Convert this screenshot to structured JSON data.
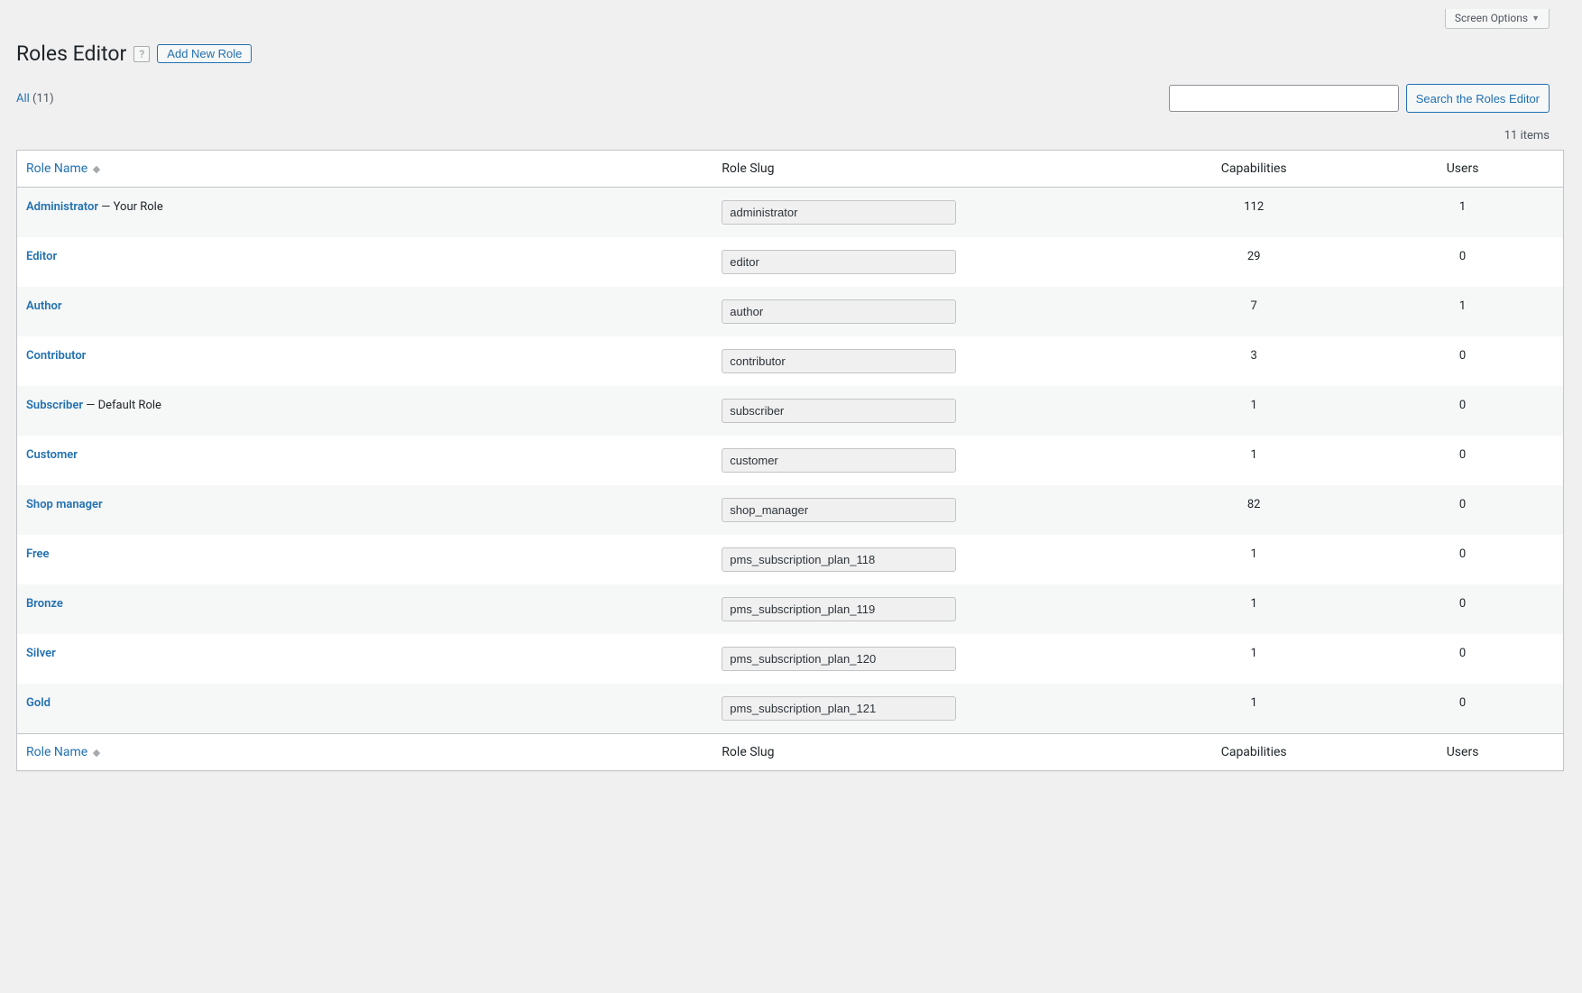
{
  "screenOptions": {
    "label": "Screen Options"
  },
  "header": {
    "title": "Roles Editor",
    "addNew": "Add New Role"
  },
  "filter": {
    "allLabel": "All",
    "allCount": "(11)"
  },
  "search": {
    "value": "",
    "button": "Search the Roles Editor"
  },
  "pagination": {
    "itemsLabel": "11 items"
  },
  "columns": {
    "name": "Role Name",
    "slug": "Role Slug",
    "caps": "Capabilities",
    "users": "Users"
  },
  "rows": [
    {
      "name": "Administrator",
      "note": " — Your Role",
      "slug": "administrator",
      "caps": "112",
      "users": "1"
    },
    {
      "name": "Editor",
      "note": "",
      "slug": "editor",
      "caps": "29",
      "users": "0"
    },
    {
      "name": "Author",
      "note": "",
      "slug": "author",
      "caps": "7",
      "users": "1"
    },
    {
      "name": "Contributor",
      "note": "",
      "slug": "contributor",
      "caps": "3",
      "users": "0"
    },
    {
      "name": "Subscriber",
      "note": " — Default Role",
      "slug": "subscriber",
      "caps": "1",
      "users": "0"
    },
    {
      "name": "Customer",
      "note": "",
      "slug": "customer",
      "caps": "1",
      "users": "0"
    },
    {
      "name": "Shop manager",
      "note": "",
      "slug": "shop_manager",
      "caps": "82",
      "users": "0"
    },
    {
      "name": "Free",
      "note": "",
      "slug": "pms_subscription_plan_118",
      "caps": "1",
      "users": "0"
    },
    {
      "name": "Bronze",
      "note": "",
      "slug": "pms_subscription_plan_119",
      "caps": "1",
      "users": "0"
    },
    {
      "name": "Silver",
      "note": "",
      "slug": "pms_subscription_plan_120",
      "caps": "1",
      "users": "0"
    },
    {
      "name": "Gold",
      "note": "",
      "slug": "pms_subscription_plan_121",
      "caps": "1",
      "users": "0"
    }
  ]
}
